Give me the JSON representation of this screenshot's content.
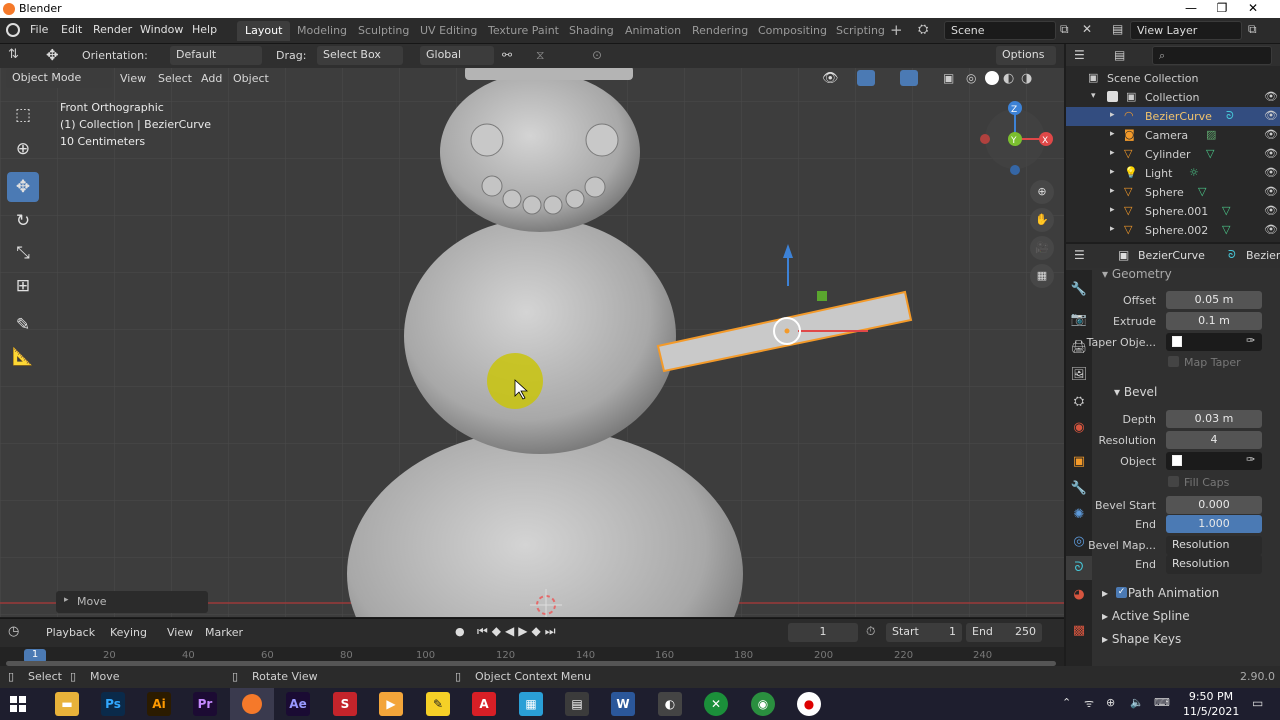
{
  "titlebar": {
    "title": "Blender",
    "minimize": "—",
    "maximize": "❐",
    "close": "✕"
  },
  "menus": [
    "File",
    "Edit",
    "Render",
    "Window",
    "Help"
  ],
  "workspaces": [
    "Layout",
    "Modeling",
    "Sculpting",
    "UV Editing",
    "Texture Paint",
    "Shading",
    "Animation",
    "Rendering",
    "Compositing",
    "Scripting"
  ],
  "active_workspace": "Layout",
  "scene": "Scene",
  "view_layer": "View Layer",
  "toolbar": {
    "orientation_label": "Orientation:",
    "orientation_value": "Default",
    "drag_label": "Drag:",
    "drag_value": "Select Box",
    "transform_value": "Global",
    "options": "Options"
  },
  "viewport_header": {
    "mode": "Object Mode",
    "view": "View",
    "select": "Select",
    "add": "Add",
    "object": "Object"
  },
  "viewport_overlay": {
    "line1": "Front Orthographic",
    "line2": "(1) Collection | BezierCurve",
    "line3": "10 Centimeters"
  },
  "gizmo": {
    "z": "Z",
    "y": "Y",
    "x": "X"
  },
  "last_operator": "Move",
  "outliner": {
    "scene_collection": "Scene Collection",
    "collection": "Collection",
    "items": [
      "BezierCurve",
      "Camera",
      "Cylinder",
      "Light",
      "Sphere",
      "Sphere.001",
      "Sphere.002"
    ],
    "selected": "BezierCurve"
  },
  "properties": {
    "object_name": "BezierCurve",
    "data_name": "BezierC",
    "geometry_header": "Geometry",
    "offset_label": "Offset",
    "offset_value": "0.05 m",
    "extrude_label": "Extrude",
    "extrude_value": "0.1 m",
    "taper_label": "Taper Obje...",
    "map_taper": "Map Taper",
    "bevel_header": "Bevel",
    "depth_label": "Depth",
    "depth_value": "0.03 m",
    "resolution_label": "Resolution",
    "resolution_value": "4",
    "object_label": "Object",
    "fill_caps": "Fill Caps",
    "bevel_start_label": "Bevel Start",
    "bevel_start_value": "0.000",
    "end_label": "End",
    "end_value": "1.000",
    "bevel_map_label": "Bevel Map...",
    "bevel_map_value": "Resolution",
    "end2_label": "End",
    "end2_value": "Resolution",
    "path_animation": "Path Animation",
    "active_spline": "Active Spline",
    "shape_keys": "Shape Keys"
  },
  "timeline": {
    "playback": "Playback",
    "keying": "Keying",
    "view": "View",
    "marker": "Marker",
    "current_frame": "1",
    "start_label": "Start",
    "start": "1",
    "end_label": "End",
    "end": "250",
    "ruler": [
      "1",
      "20",
      "40",
      "60",
      "80",
      "100",
      "120",
      "140",
      "160",
      "180",
      "200",
      "220",
      "240"
    ]
  },
  "statusbar": {
    "select": "Select",
    "move": "Move",
    "rotate": "Rotate View",
    "context": "Object Context Menu",
    "version": "2.90.0"
  },
  "taskbar": {
    "time": "9:50 PM",
    "date": "11/5/2021"
  },
  "colors": {
    "accent": "#4b7ab4",
    "selection": "#f39a2a",
    "viewport": "#3d3d3d"
  }
}
